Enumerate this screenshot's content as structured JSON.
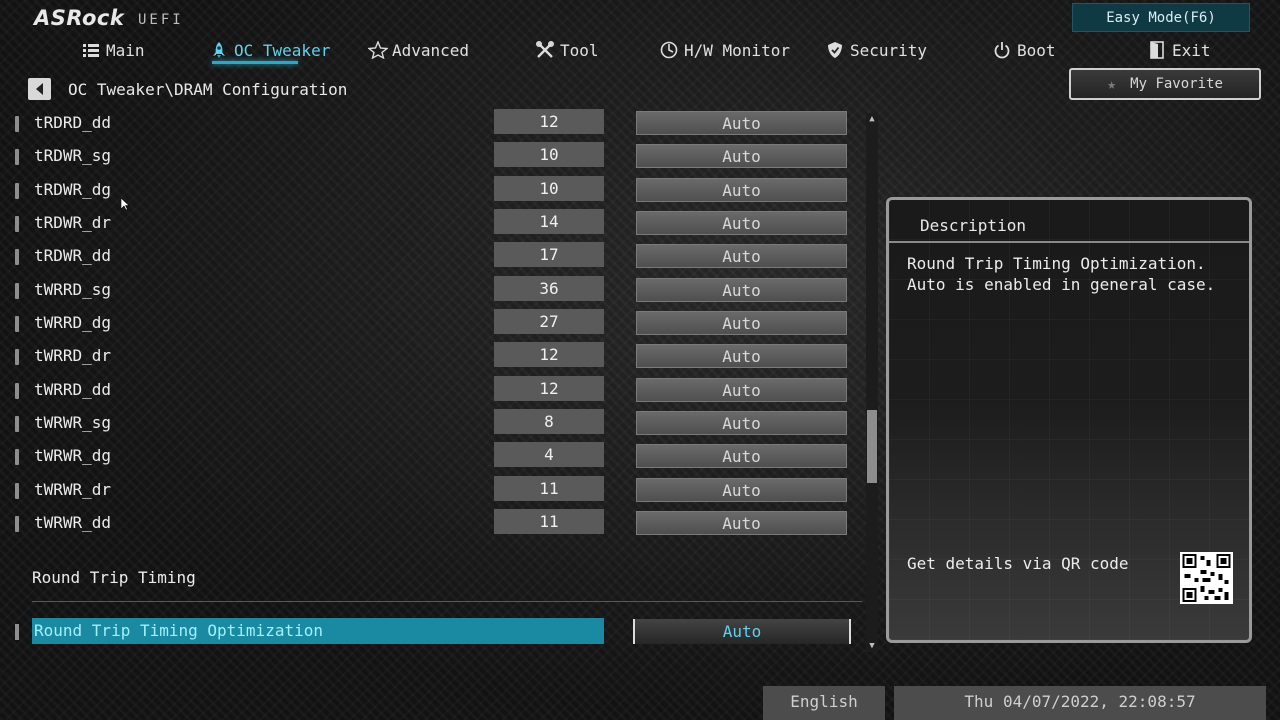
{
  "header": {
    "logo": "ASRock",
    "logo_sub": "UEFI",
    "easy_mode": "Easy Mode(F6)"
  },
  "nav": {
    "items": [
      {
        "label": "Main",
        "icon": "list-icon"
      },
      {
        "label": "OC Tweaker",
        "icon": "rocket-icon",
        "active": true
      },
      {
        "label": "Advanced",
        "icon": "star-icon"
      },
      {
        "label": "Tool",
        "icon": "wrench-icon"
      },
      {
        "label": "H/W Monitor",
        "icon": "monitor-icon"
      },
      {
        "label": "Security",
        "icon": "shield-icon"
      },
      {
        "label": "Boot",
        "icon": "power-icon"
      },
      {
        "label": "Exit",
        "icon": "exit-door-icon"
      }
    ]
  },
  "breadcrumb": "OC Tweaker\\DRAM Configuration",
  "favorite": {
    "label": "My Favorite"
  },
  "settings": [
    {
      "name": "tRDRD_dd",
      "value": "12",
      "mode": "Auto"
    },
    {
      "name": "tRDWR_sg",
      "value": "10",
      "mode": "Auto"
    },
    {
      "name": "tRDWR_dg",
      "value": "10",
      "mode": "Auto"
    },
    {
      "name": "tRDWR_dr",
      "value": "14",
      "mode": "Auto"
    },
    {
      "name": "tRDWR_dd",
      "value": "17",
      "mode": "Auto"
    },
    {
      "name": "tWRRD_sg",
      "value": "36",
      "mode": "Auto"
    },
    {
      "name": "tWRRD_dg",
      "value": "27",
      "mode": "Auto"
    },
    {
      "name": "tWRRD_dr",
      "value": "12",
      "mode": "Auto"
    },
    {
      "name": "tWRRD_dd",
      "value": "12",
      "mode": "Auto"
    },
    {
      "name": "tWRWR_sg",
      "value": "8",
      "mode": "Auto"
    },
    {
      "name": "tWRWR_dg",
      "value": "4",
      "mode": "Auto"
    },
    {
      "name": "tWRWR_dr",
      "value": "11",
      "mode": "Auto"
    },
    {
      "name": "tWRWR_dd",
      "value": "11",
      "mode": "Auto"
    }
  ],
  "section": {
    "title": "Round Trip Timing",
    "selected_item": {
      "name": "Round Trip Timing Optimization",
      "mode": "Auto"
    }
  },
  "description": {
    "title": "Description",
    "text": "Round Trip Timing Optimization.\nAuto is enabled in general case.",
    "qr_label": "Get details via QR code"
  },
  "footer": {
    "language": "English",
    "datetime": "Thu 04/07/2022, 22:08:57"
  },
  "colors": {
    "accent": "#1a8aa2",
    "active_text": "#5fd2ee"
  }
}
